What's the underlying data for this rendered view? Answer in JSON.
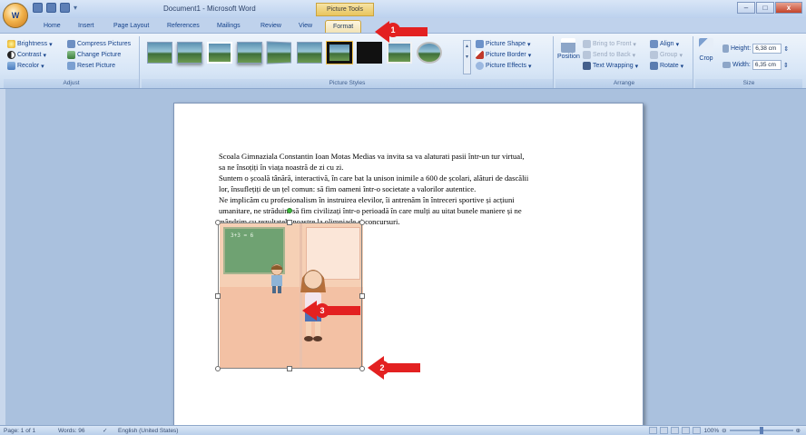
{
  "window": {
    "title": "Document1 - Microsoft Word",
    "contextual_group": "Picture Tools",
    "controls": {
      "minimize": "–",
      "maximize": "□",
      "close": "x"
    }
  },
  "office_button": {
    "label": "W"
  },
  "tabs": [
    "Home",
    "Insert",
    "Page Layout",
    "References",
    "Mailings",
    "Review",
    "View",
    "Format"
  ],
  "active_tab": "Format",
  "ribbon": {
    "adjust": {
      "label": "Adjust",
      "brightness": "Brightness",
      "contrast": "Contrast",
      "recolor": "Recolor",
      "compress": "Compress Pictures",
      "change": "Change Picture",
      "reset": "Reset Picture"
    },
    "picture_styles": {
      "label": "Picture Styles",
      "shape": "Picture Shape",
      "border": "Picture Border",
      "effects": "Picture Effects"
    },
    "arrange": {
      "label": "Arrange",
      "position": "Position",
      "bring_front": "Bring to Front",
      "send_back": "Send to Back",
      "text_wrapping": "Text Wrapping",
      "align": "Align",
      "group": "Group",
      "rotate": "Rotate"
    },
    "size": {
      "label": "Size",
      "crop": "Crop",
      "height_label": "Height:",
      "height_value": "6,38 cm",
      "width_label": "Width:",
      "width_value": "6,35 cm"
    }
  },
  "document": {
    "lines": [
      "Scoala Gimnaziala Constantin Ioan Motas Medias va invita sa va alaturati pasii într-un tur virtual,",
      "sa ne însoțiți în viața noastră de zi cu zi.",
      "Suntem o școală tânără, interactivă, în care bat la unison inimile a 600 de școlari, alături de dascălii",
      "lor, însuflețiți de un țel comun: să fim oameni într-o societate a valorilor autentice.",
      "Ne implicăm cu profesionalism în instruirea elevilor, îi antrenăm în întreceri sportive și acțiuni",
      "umanitare, ne străduim să fim civilizați într-o perioadă în care mulți au uitat bunele maniere și ne",
      "mândrim cu rezultatele noastre la olimpiade și concursuri."
    ],
    "board_text": "3+3 = 6"
  },
  "annotations": {
    "a1": "1",
    "a2": "2",
    "a3": "3",
    "color": "#e32121"
  },
  "status": {
    "page": "Page: 1 of 1",
    "words": "Words: 96",
    "language": "English (United States)",
    "zoom": "100%"
  }
}
